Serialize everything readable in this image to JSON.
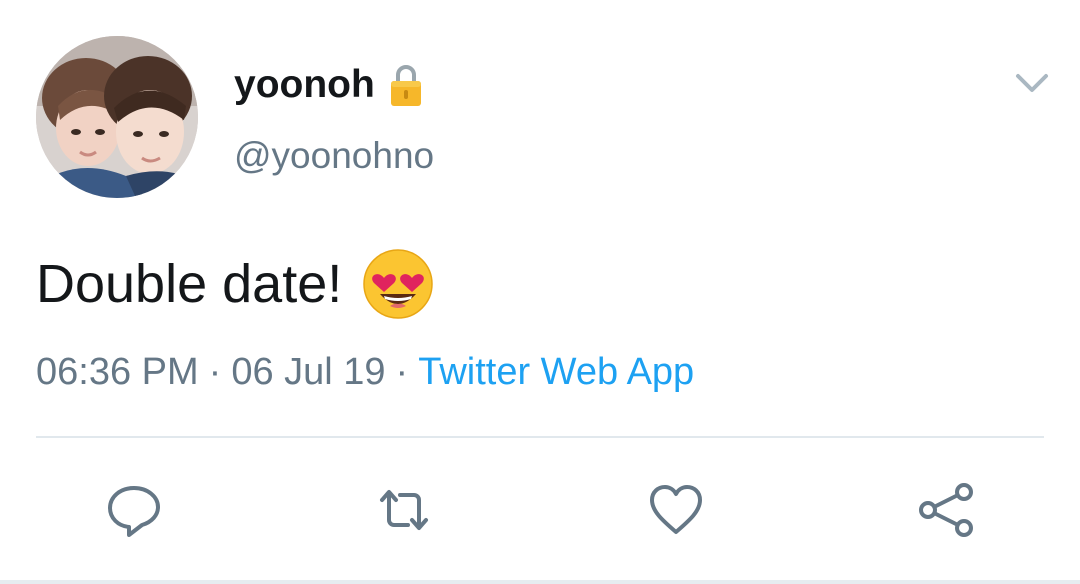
{
  "user": {
    "display_name": "yoonoh",
    "handle": "@yoonohno",
    "protected_icon": "lock-icon"
  },
  "tweet": {
    "text": "Double date!",
    "emoji": "smiling-face-with-heart-eyes-icon"
  },
  "meta": {
    "time": "06:36 PM",
    "separator": "·",
    "date": "06 Jul 19",
    "source": "Twitter Web App"
  },
  "actions": {
    "reply": "reply-icon",
    "retweet": "retweet-icon",
    "like": "like-icon",
    "share": "share-icon"
  },
  "colors": {
    "text": "#14171a",
    "secondary": "#657786",
    "link": "#1da1f2",
    "divider": "#e1e8ed",
    "icon": "#657786"
  }
}
